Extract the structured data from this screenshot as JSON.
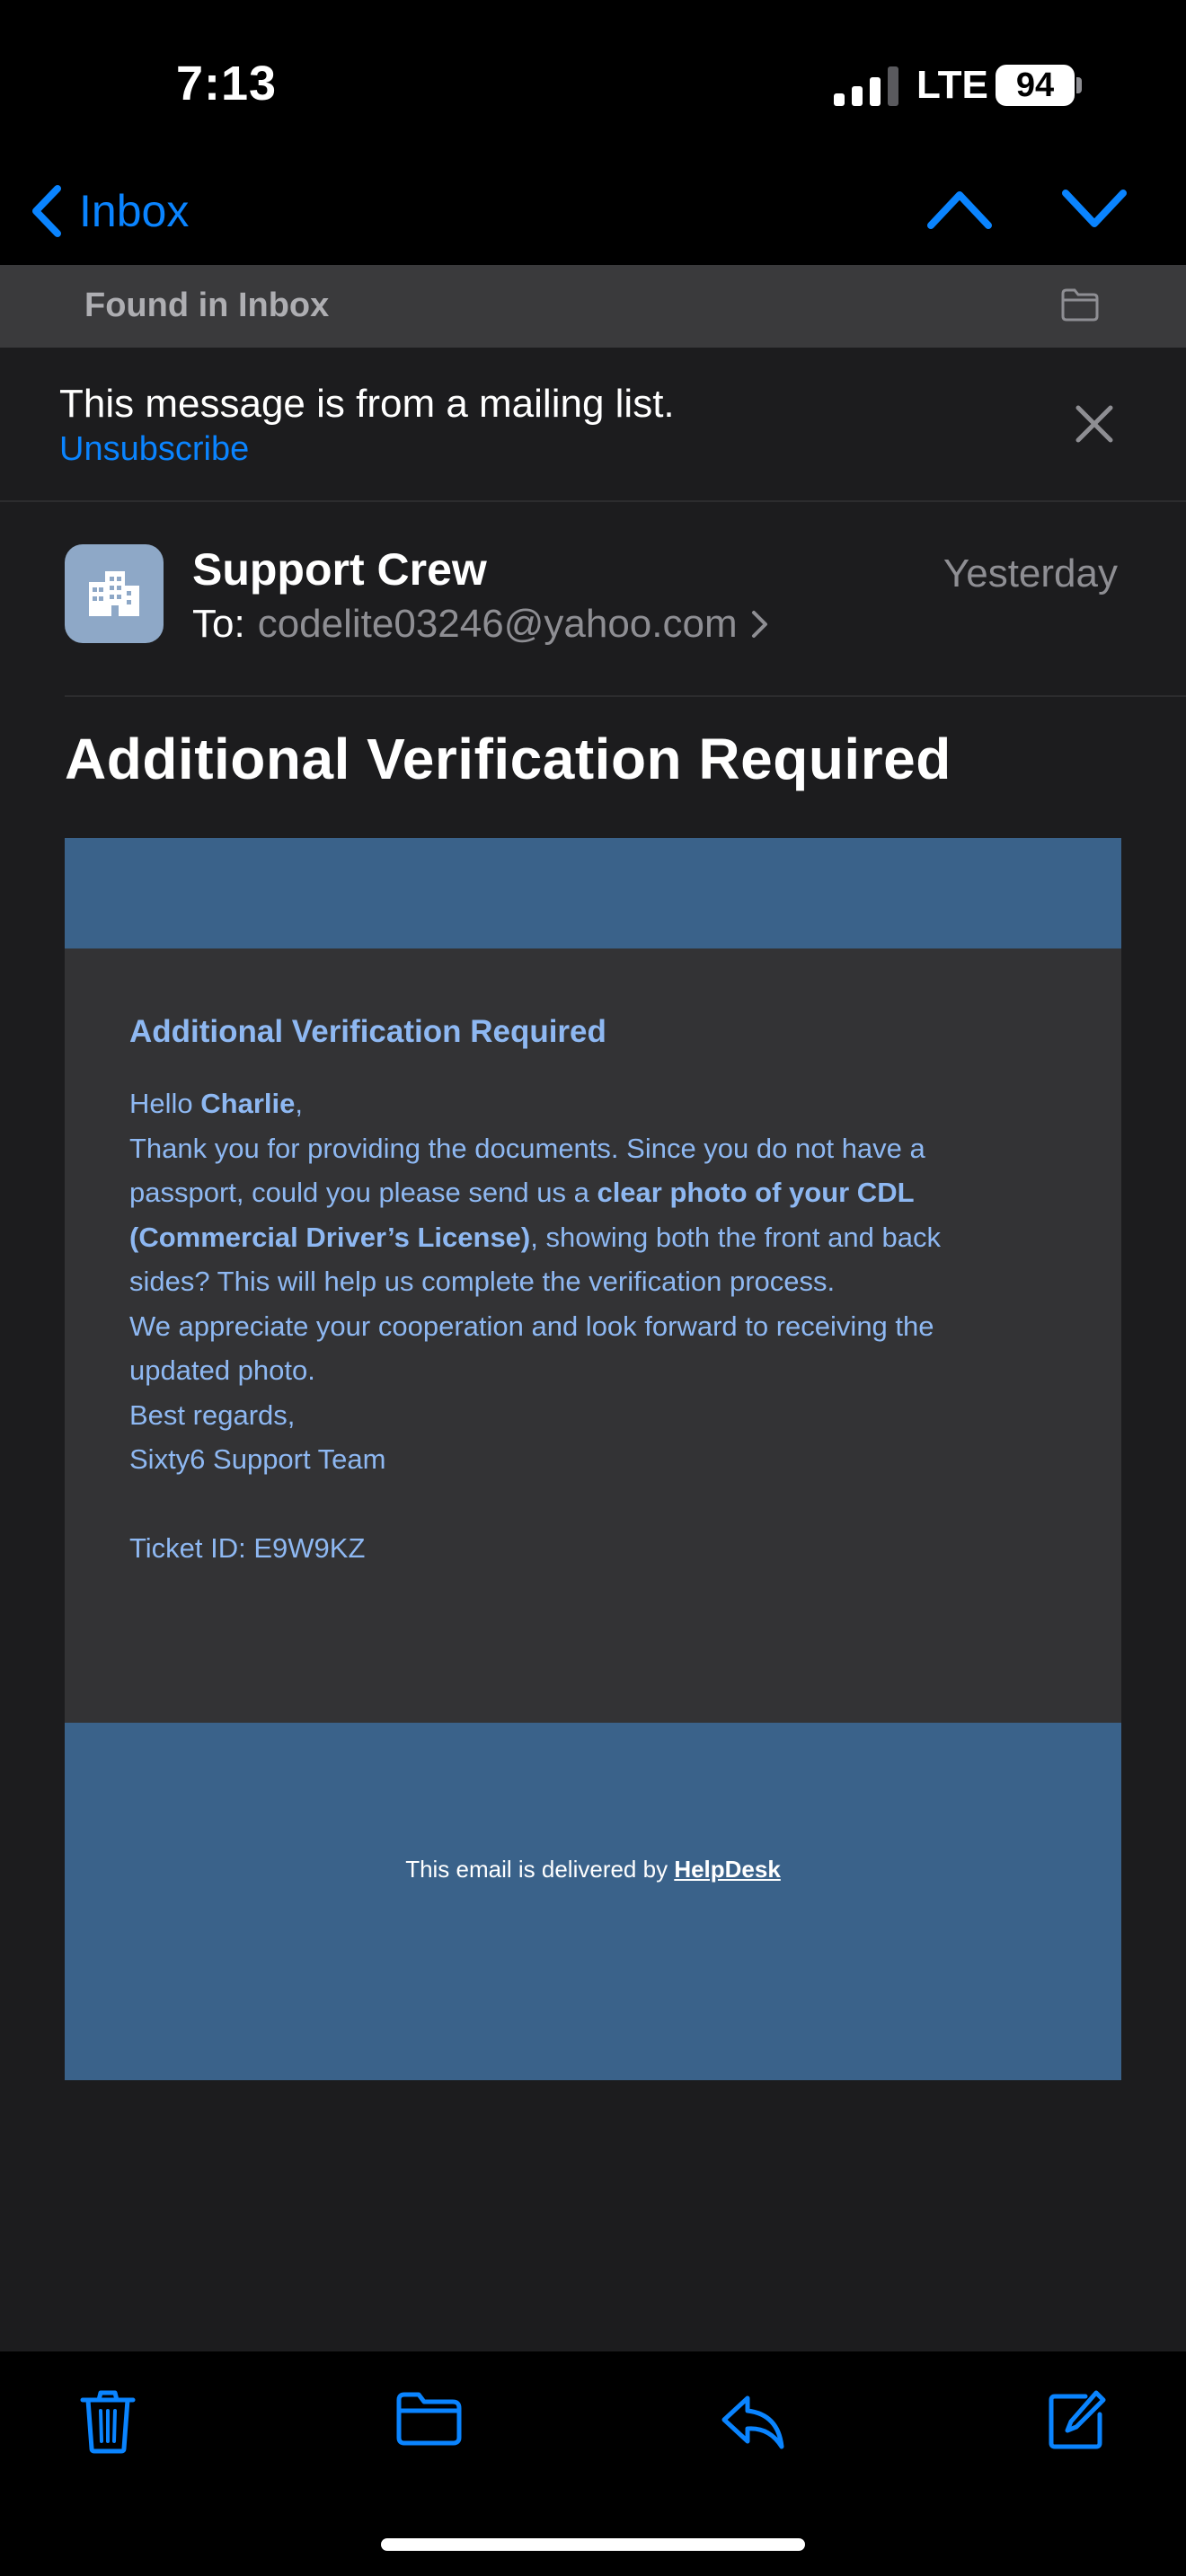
{
  "status_bar": {
    "time": "7:13",
    "network": "LTE",
    "battery": "94"
  },
  "nav": {
    "back_label": "Inbox",
    "back_icon": "chevron-left-icon",
    "prev_icon": "chevron-up-icon",
    "next_icon": "chevron-down-icon"
  },
  "found_bar": {
    "label": "Found in Inbox",
    "icon": "folder-icon"
  },
  "mailing_banner": {
    "message": "This message is from a mailing list.",
    "unsubscribe": "Unsubscribe",
    "dismiss_icon": "close-icon"
  },
  "header": {
    "sender": "Support Crew",
    "to_label": "To:",
    "to_address": "codelite03246@yahoo.com",
    "date": "Yesterday",
    "avatar_icon": "building-icon"
  },
  "subject": "Additional Verification Required",
  "email": {
    "title": "Additional Verification Required",
    "greeting_prefix": "Hello ",
    "greeting_name": "Charlie",
    "greeting_suffix": ",",
    "line1": "Thank you for providing the documents. Since you do not have a",
    "line2_prefix": "passport, could you please send us a ",
    "line2_bold": "clear photo of your CDL",
    "line3_bold": "(Commercial Driver’s License)",
    "line3_suffix": ", showing both the front and back",
    "line4": "sides? This will help us complete the verification process.",
    "line5": "We appreciate your cooperation and look forward to receiving the",
    "line6": "updated photo.",
    "line7": "Best regards,",
    "line8": "Sixty6 Support Team",
    "ticket": "Ticket ID: E9W9KZ",
    "footer_prefix": "This email is delivered by ",
    "footer_link": "HelpDesk",
    "band_color": "#3a628a",
    "text_color": "#8eb8f2"
  },
  "toolbar": {
    "icons": [
      "trash-icon",
      "folder-icon",
      "reply-icon",
      "compose-icon"
    ]
  },
  "colors": {
    "accent": "#0a84ff",
    "background": "#1c1c1e"
  }
}
